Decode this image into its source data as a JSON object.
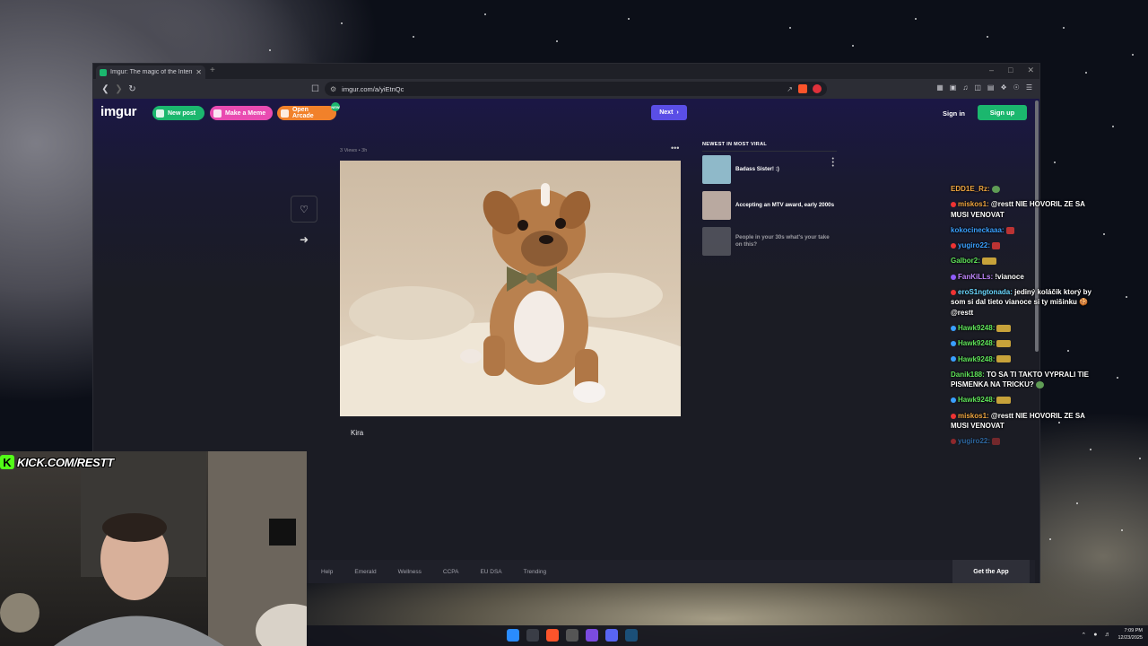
{
  "browser": {
    "tab_title": "Imgur: The magic of the Internet",
    "tab_close": "✕",
    "new_tab": "+",
    "url": "imgur.com/a/yiEtnQc"
  },
  "imgur": {
    "logo": "imgur",
    "new_post": "New post",
    "make_meme": "Make a Meme",
    "open_arcade": "Open Arcade",
    "arcade_badge": "NEW",
    "next": "Next",
    "sign_in": "Sign in",
    "sign_up": "Sign up",
    "post_meta": "3 Views • 3h",
    "post_menu": "•••",
    "caption": "Kira",
    "viral_heading": "NEWEST IN MOST VIRAL",
    "viral_items": [
      {
        "title": "Badass Sister! :)",
        "thumb_color": "#8fb9c9"
      },
      {
        "title": "Accepting an MTV award, early 2000s",
        "thumb_color": "#b9a9a0"
      },
      {
        "title": "People in your 30s what's your take on this?",
        "thumb_color": "#77787e"
      }
    ],
    "footer_links": [
      "Help",
      "Emerald",
      "Wellness",
      "CCPA",
      "EU DSA",
      "Trending"
    ],
    "get_app": "Get the App"
  },
  "chat": [
    {
      "user": "EDD1E_Rz:",
      "text": "",
      "color": "u-orange",
      "emote": "globe"
    },
    {
      "user": "miskos1:",
      "text": "@restt NIE HOVORIL ZE SA MUSI VENOVAT",
      "color": "u-orange",
      "badge": "#e33"
    },
    {
      "user": "kokocineckaaa:",
      "text": "",
      "color": "u-blue",
      "emote": "red"
    },
    {
      "user": "yugiro22:",
      "text": "",
      "color": "u-blue",
      "emote": "red",
      "badge": "#e33"
    },
    {
      "user": "Galbor2:",
      "text": "",
      "color": "u-green",
      "emote": "turtle"
    },
    {
      "user": "FanKiLLs:",
      "text": "!vianoce",
      "color": "u-purple",
      "badge": "#8f5cff"
    },
    {
      "user": "eroS1ngtonada:",
      "text": "jediný koláčik ktorý by som si dal tieto vianoce si ty mišinku 🍪 @restt",
      "color": "u-cyan",
      "badge": "#e33"
    },
    {
      "user": "Hawk9248:",
      "text": "",
      "color": "u-green",
      "emote": "turtle",
      "badge": "#3aa0ff"
    },
    {
      "user": "Hawk9248:",
      "text": "",
      "color": "u-green",
      "emote": "turtle",
      "badge": "#3aa0ff"
    },
    {
      "user": "Hawk9248:",
      "text": "",
      "color": "u-green",
      "emote": "turtle",
      "badge": "#3aa0ff"
    },
    {
      "user": "Danik188:",
      "text": "TO SA TI TAKTO VYPRALI TIE PISMENKA NA TRICKU?",
      "color": "u-green",
      "emote": "globe"
    },
    {
      "user": "Hawk9248:",
      "text": "",
      "color": "u-green",
      "emote": "turtle",
      "badge": "#3aa0ff"
    },
    {
      "user": "miskos1:",
      "text": "@restt NIE HOVORIL ZE SA MUSI VENOVAT",
      "color": "u-orange",
      "badge": "#e33"
    },
    {
      "user": "yugiro22:",
      "text": "",
      "color": "u-blue",
      "emote": "red",
      "badge": "#e33",
      "fade": true
    }
  ],
  "stream": {
    "kick_tag": "KICK.COM/RESTT"
  },
  "taskbar": {
    "time": "7:09 PM",
    "date": "12/23/2025"
  }
}
